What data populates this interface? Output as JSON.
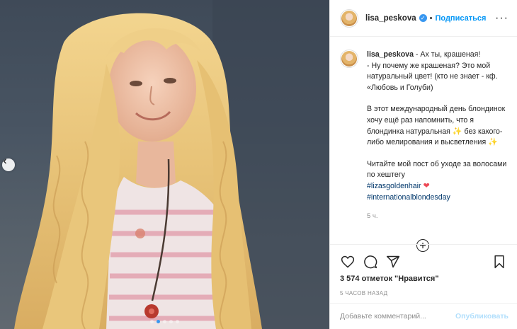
{
  "post": {
    "username": "lisa_peskova",
    "verified_icon": "verified-badge-icon",
    "separator": "•",
    "follow_label": "Подписаться",
    "more_label": "···"
  },
  "caption": {
    "username": "lisa_peskova",
    "line1": " - Ах ты, крашеная!",
    "line2": "- Ну почему же крашеная? Это мой натуральный цвет! (кто не знает - кф. «Любовь и Голуби)",
    "line3": "В этот международный день блондинок хочу ещё раз напомнить, что я блондинка натуральная",
    "line3b": "без какого-либо мелирования и высветления",
    "line4": "Читайте мой пост об уходе за волосами по хештегу",
    "hashtag1": "#lizasgoldenhair",
    "hashtag2": "#internationalblondesday",
    "time": "5 ч."
  },
  "actions": {
    "likes": "3 574 отметок \"Нравится\"",
    "posted": "5 ЧАСОВ НАЗАД",
    "icons": [
      "heart-icon",
      "comment-icon",
      "share-icon",
      "bookmark-icon"
    ]
  },
  "comment": {
    "placeholder": "Добавьте комментарий...",
    "publish_label": "Опубликовать"
  },
  "colors": {
    "accent": "#0095f6",
    "publish_disabled": "#b2dffc",
    "muted": "#8e8e8e",
    "heart": "#ed4956"
  }
}
